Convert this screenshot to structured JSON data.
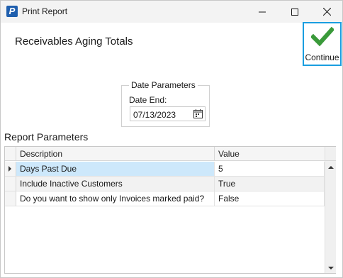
{
  "window": {
    "title": "Print Report",
    "app_icon_letter": "P",
    "icons": [
      "app-icon",
      "minimize-icon",
      "maximize-icon",
      "close-icon"
    ]
  },
  "header": {
    "title": "Receivables Aging Totals"
  },
  "continue_button": {
    "label": "Continue",
    "icon": "checkmark-icon",
    "accent_color": "#1a9ee0",
    "check_color": "#3a9a3a"
  },
  "date_parameters": {
    "legend": "Date Parameters",
    "date_end_label": "Date End:",
    "date_end_value": "07/13/2023",
    "icon": "calendar-icon"
  },
  "report_parameters": {
    "title": "Report Parameters",
    "columns": [
      "Description",
      "Value"
    ],
    "rows": [
      {
        "description": "Days Past Due",
        "value": "5"
      },
      {
        "description": "Include Inactive Customers",
        "value": "True"
      },
      {
        "description": "Do you want to show only Invoices marked paid?",
        "value": "False"
      }
    ],
    "selected_row_color": "#cde8fb"
  }
}
